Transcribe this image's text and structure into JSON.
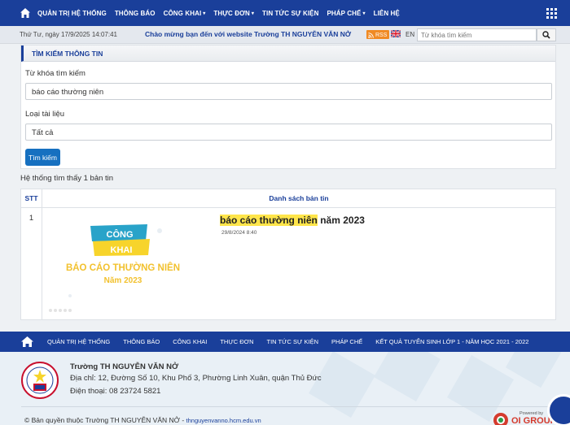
{
  "topnav": {
    "items": [
      {
        "label": "QUẢN TRỊ HỆ THỐNG",
        "caret": ""
      },
      {
        "label": "THÔNG BÁO",
        "caret": ""
      },
      {
        "label": "CÔNG KHAI",
        "caret": "▾"
      },
      {
        "label": "THỰC ĐƠN",
        "caret": "▾"
      },
      {
        "label": "TIN TỨC SỰ KIỆN",
        "caret": ""
      },
      {
        "label": "PHÁP CHẾ",
        "caret": "▾"
      },
      {
        "label": "LIÊN HỆ",
        "caret": ""
      }
    ]
  },
  "infobar": {
    "date": "Thứ Tư, ngày 17/9/2025 14:07:41",
    "welcome": "Chào mừng bạn đến với website Trường TH NGUYỄN VĂN NỞ",
    "rss": "RSS",
    "lang": "EN",
    "search_placeholder": "Từ khóa tìm kiếm"
  },
  "search_panel": {
    "title": "TÌM KIẾM THÔNG TIN",
    "keyword_label": "Từ khóa tìm kiếm",
    "keyword_value": "báo cáo thường niên",
    "type_label": "Loại tài liệu",
    "type_value": "Tất cả",
    "button": "Tìm kiếm"
  },
  "results": {
    "found_text": "Hệ thống tìm thấy 1 bản tin",
    "col_stt": "STT",
    "col_list": "Danh sách bản tin",
    "rows": [
      {
        "stt": "1",
        "title_highlight": "báo cáo thường niên",
        "title_rest": " năm 2023",
        "date": "29/8/2024 8:40",
        "thumb_badge_1": "CÔNG",
        "thumb_badge_2": "KHAI",
        "thumb_line_1": "BÁO CÁO THƯỜNG NIÊN",
        "thumb_line_2": "Năm 2023"
      }
    ]
  },
  "footnav": {
    "items": [
      "QUẢN TRỊ HỆ THỐNG",
      "THÔNG BÁO",
      "CÔNG KHAI",
      "THỰC ĐƠN",
      "TIN TỨC SỰ KIỆN",
      "PHÁP CHẾ",
      "KẾT QUẢ TUYỂN SINH LỚP 1 - NĂM HỌC 2021 - 2022"
    ]
  },
  "footer": {
    "school": "Trường TH NGUYỄN VĂN NỞ",
    "address": "Địa chỉ: 12, Đường Số 10, Khu Phố 3, Phường Linh Xuân, quận Thủ Đức",
    "phone": "Điện thoại: 08 23724 5821",
    "copyright": "© Bản quyền thuộc Trường TH NGUYỄN VĂN NỞ - ",
    "site": "thnguyenvanno.hcm.edu.vn",
    "powered_by": "Powered by",
    "powered_brand": "OI GROUP"
  },
  "colors": {
    "primary": "#1a3f9a",
    "button": "#1670c0",
    "highlight": "#ffe54a",
    "rss": "#f08a24"
  }
}
